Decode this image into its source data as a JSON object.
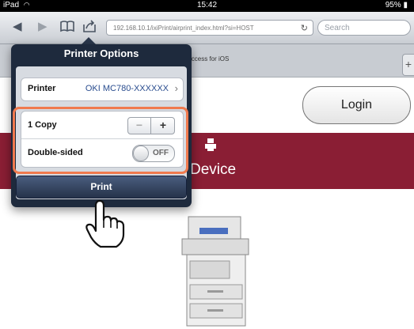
{
  "status_bar": {
    "device": "iPad",
    "time": "15:42",
    "battery": "95%"
  },
  "toolbar": {
    "url": "192.168.10.1/ixiPrint/airprint_index.html?si=HOST",
    "search_placeholder": "Search"
  },
  "tab": {
    "label": "pAccess for iOS",
    "add_label": "+"
  },
  "page": {
    "login_label": "Login",
    "banner_title": "Device"
  },
  "popover": {
    "title": "Printer Options",
    "printer_label": "Printer",
    "printer_value": "OKI MC780-XXXXXX",
    "copies_label": "1 Copy",
    "stepper_minus": "−",
    "stepper_plus": "+",
    "double_sided_label": "Double-sided",
    "double_sided_value": "OFF",
    "print_label": "Print"
  },
  "colors": {
    "banner": "#8a1e34",
    "highlight": "#f07a4e",
    "popover": "#1e2a3d"
  }
}
